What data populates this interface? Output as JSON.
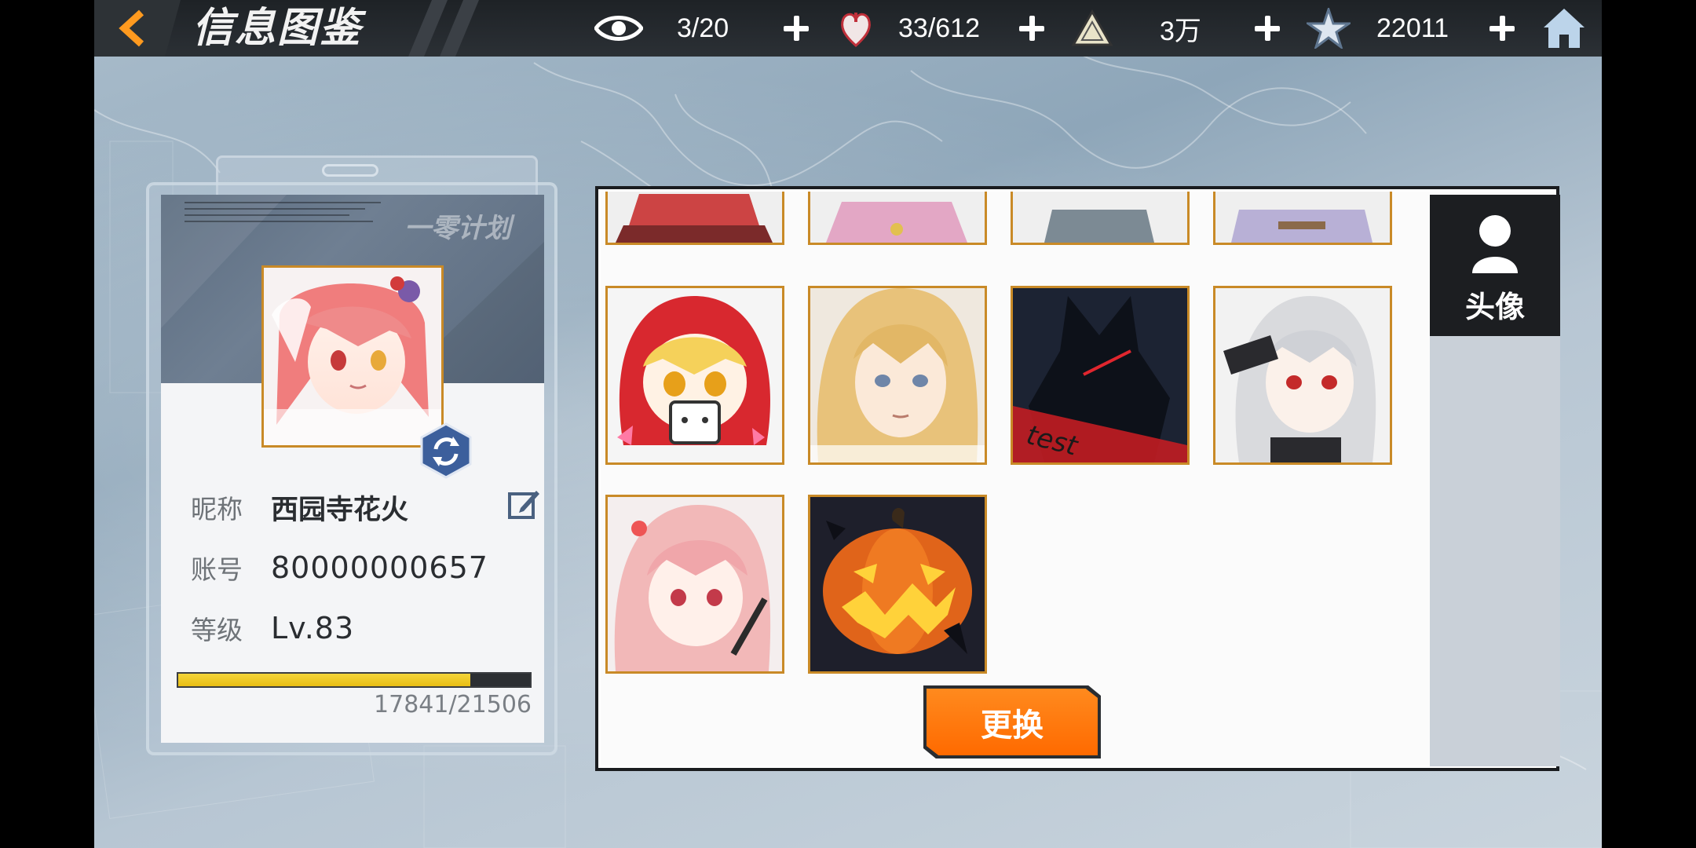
{
  "header": {
    "title": "信息图鉴",
    "resources": [
      {
        "icon": "eye-icon",
        "value": "3/20"
      },
      {
        "icon": "heart-icon",
        "value": "33/612"
      },
      {
        "icon": "triangle-emblem-icon",
        "value": "3万"
      },
      {
        "icon": "star-crystal-icon",
        "value": "22011"
      }
    ]
  },
  "profile": {
    "logo_text": "一零计划",
    "nickname_label": "昵称",
    "nickname": "西园寺花火",
    "account_label": "账号",
    "account": "80000000657",
    "level_label": "等级",
    "level": "Lv.83",
    "exp_text": "17841/21506",
    "exp_current": 17841,
    "exp_max": 21506
  },
  "avatar_grid": {
    "tiles": [
      {
        "name": "avatar-tile-partial-1"
      },
      {
        "name": "avatar-tile-partial-2"
      },
      {
        "name": "avatar-tile-partial-3"
      },
      {
        "name": "avatar-tile-partial-4"
      },
      {
        "name": "avatar-tile-red-hood-girl"
      },
      {
        "name": "avatar-tile-blonde-girl"
      },
      {
        "name": "avatar-tile-dark-knight",
        "label": "test"
      },
      {
        "name": "avatar-tile-white-hair-girl"
      },
      {
        "name": "avatar-tile-pink-hair-girl"
      },
      {
        "name": "avatar-tile-pumpkin"
      }
    ],
    "confirm_label": "更换"
  },
  "side_tabs": [
    {
      "label": "头像",
      "icon": "person-icon",
      "active": true
    }
  ],
  "colors": {
    "accent_orange": "#ff7a10",
    "tile_border": "#c98a27",
    "exp_fill": "#f0c820"
  }
}
